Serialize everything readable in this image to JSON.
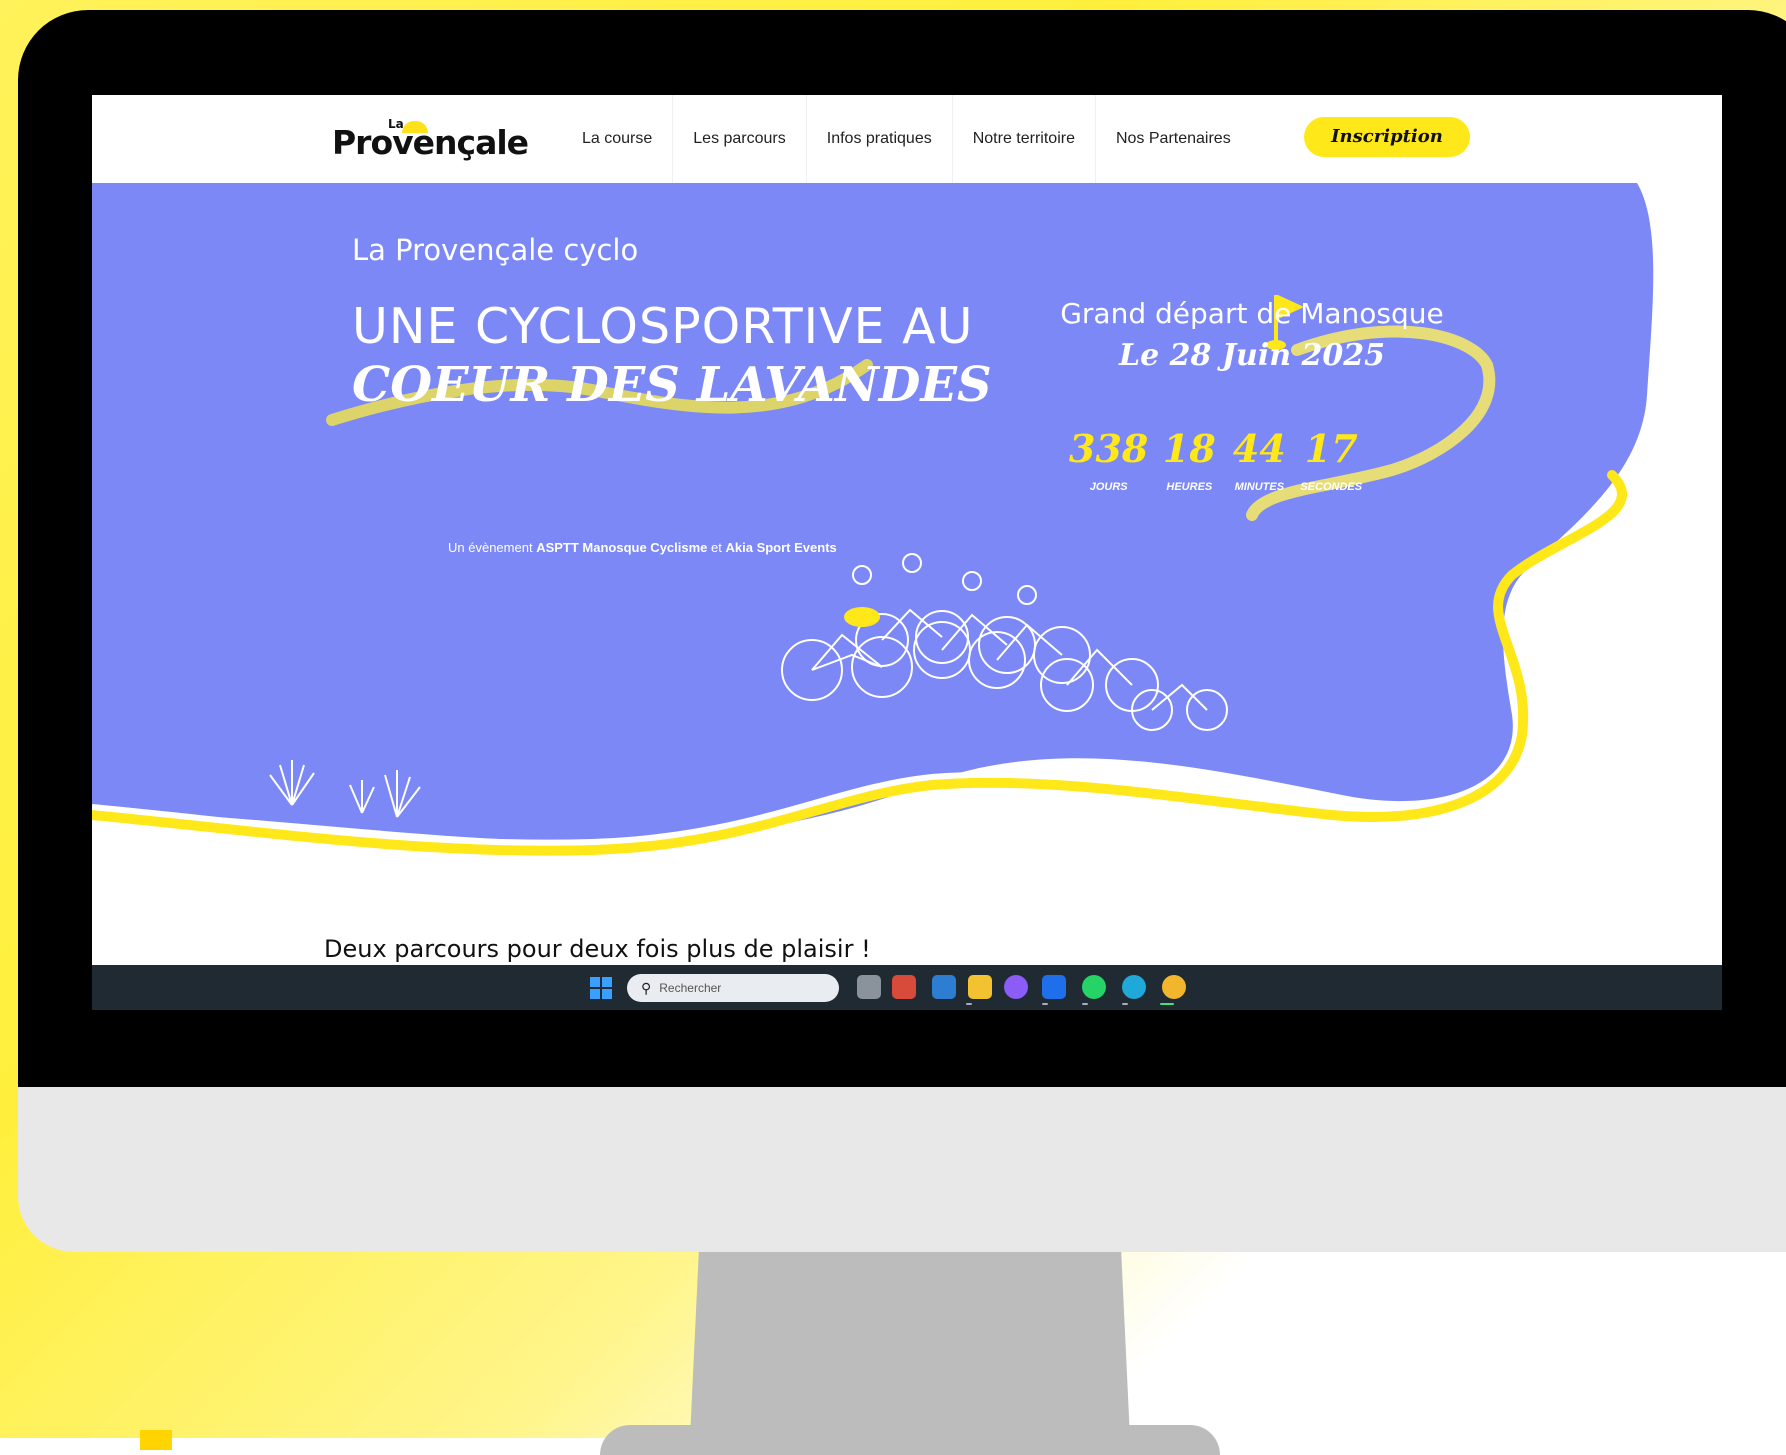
{
  "header": {
    "logo_small": "La",
    "logo_main": "Provençale",
    "nav": [
      "La course",
      "Les parcours",
      "Infos pratiques",
      "Notre territoire",
      "Nos Partenaires"
    ],
    "cta": "Inscription"
  },
  "hero": {
    "eyebrow": "La Provençale cyclo",
    "title_line1": "UNE CYCLOSPORTIVE AU",
    "title_line2": "COEUR DES LAVANDES",
    "credit_prefix": "Un évènement",
    "credit_org1": "ASPTT Manosque Cyclisme",
    "credit_and": "et",
    "credit_org2": "Akia Sport Events",
    "depart_line1": "Grand départ de Manosque",
    "depart_line2": "Le 28 Juin 2025"
  },
  "countdown": [
    {
      "value": "338",
      "label": "JOURS"
    },
    {
      "value": "18",
      "label": "HEURES"
    },
    {
      "value": "44",
      "label": "MINUTES"
    },
    {
      "value": "17",
      "label": "SECONDES"
    }
  ],
  "section": {
    "heading": "Deux parcours pour deux fois plus de plaisir !"
  },
  "taskbar": {
    "search_placeholder": "Rechercher"
  },
  "colors": {
    "hero_blue": "#7b88f5",
    "accent_yellow": "#ffe81a",
    "taskbar": "#1f2a33"
  }
}
